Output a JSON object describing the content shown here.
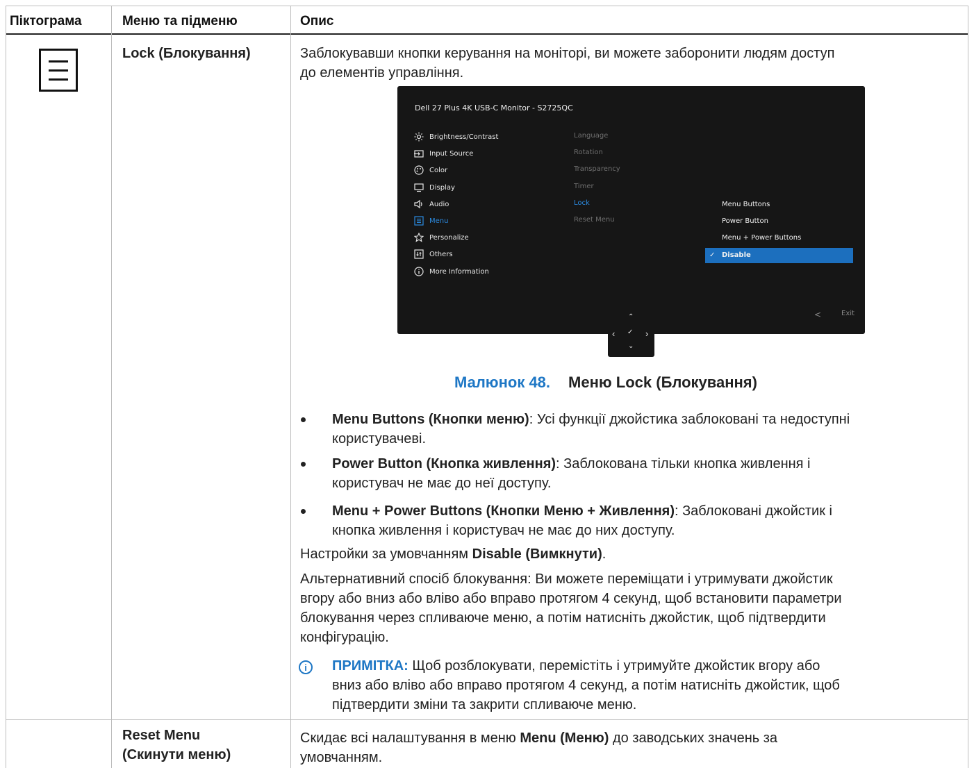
{
  "table": {
    "headers": [
      "Піктограма",
      "Меню та підменю",
      "Опис"
    ],
    "row_lock": {
      "icon": "menu-icon",
      "title": "Lock (Блокування)",
      "intro_lines": [
        "Заблокувавши кнопки керування на моніторі, ви можете заборонити людям доступ",
        "до елементів управління."
      ],
      "osd": {
        "title": "Dell 27 Plus 4K USB-C Monitor - S2725QC",
        "menu": [
          {
            "icon": "brightness-icon",
            "label": "Brightness/Contrast",
            "active": false
          },
          {
            "icon": "input-source-icon",
            "label": "Input Source",
            "active": false
          },
          {
            "icon": "color-icon",
            "label": "Color",
            "active": false
          },
          {
            "icon": "display-icon",
            "label": "Display",
            "active": false
          },
          {
            "icon": "audio-icon",
            "label": "Audio",
            "active": false
          },
          {
            "icon": "menu-icon",
            "label": "Menu",
            "active": true
          },
          {
            "icon": "personalize-icon",
            "label": "Personalize",
            "active": false
          },
          {
            "icon": "others-icon",
            "label": "Others",
            "active": false
          },
          {
            "icon": "info-icon",
            "label": "More Information",
            "active": false
          }
        ],
        "submenu": [
          {
            "label": "Language",
            "active": false
          },
          {
            "label": "Rotation",
            "active": false
          },
          {
            "label": "Transparency",
            "active": false
          },
          {
            "label": "Timer",
            "active": false
          },
          {
            "label": "Lock",
            "active": true
          },
          {
            "label": "Reset Menu",
            "active": false
          }
        ],
        "options": [
          {
            "label": "Menu Buttons",
            "selected": false
          },
          {
            "label": "Power Button",
            "selected": false
          },
          {
            "label": "Menu + Power Buttons",
            "selected": false
          },
          {
            "label": "Disable",
            "selected": true
          }
        ],
        "back": "<",
        "exit": "Exit",
        "joystick": {
          "up": "⌃",
          "left": "‹",
          "center": "✓",
          "right": "›",
          "down": "⌄"
        }
      },
      "caption": {
        "number": "Малюнок 48.",
        "title": "Меню Lock (Блокування)"
      },
      "bullets": [
        {
          "bold": "Menu Buttons (Кнопки меню)",
          "line1": ": Усі функції джойстика заблоковані та недоступні",
          "line2": "користувачеві."
        },
        {
          "bold": "Power Button (Кнопка живлення)",
          "line1": ": Заблокована тільки кнопка живлення і",
          "line2": "користувач не має до неї доступу."
        },
        {
          "bold": "Menu + Power Buttons (Кнопки Меню + Живлення)",
          "line1": ": Заблоковані джойстик і",
          "line2": "кнопка живлення і користувач не має до них доступу."
        }
      ],
      "default_prefix": "Настройки за умовчанням ",
      "default_bold": "Disable (Вимкнути)",
      "default_suffix": ".",
      "alt_lines": [
        "Альтернативний спосіб блокування: Ви можете переміщати і утримувати джойстик",
        "вгору або вниз або вліво або вправо протягом 4 секунд, щоб встановити параметри",
        "блокування через спливаюче меню, а потім натисніть джойстик, щоб підтвердити",
        "конфігурацію."
      ],
      "note": {
        "label": "ПРИМІТКА:",
        "line1": " Щоб розблокувати, перемістіть і утримуйте джойстик вгору або",
        "line2": "вниз або вліво або вправо протягом 4 секунд, а потім натисніть джойстик, щоб",
        "line3": "підтвердити зміни та закрити спливаюче меню."
      }
    },
    "row_reset": {
      "title_line1": "Reset Menu",
      "title_line2": "(Скинути меню)",
      "desc_prefix": "Скидає всі налаштування в меню ",
      "desc_bold": "Menu (Меню)",
      "desc_suffix": " до заводських значень за",
      "desc_line2": "умовчанням."
    }
  }
}
